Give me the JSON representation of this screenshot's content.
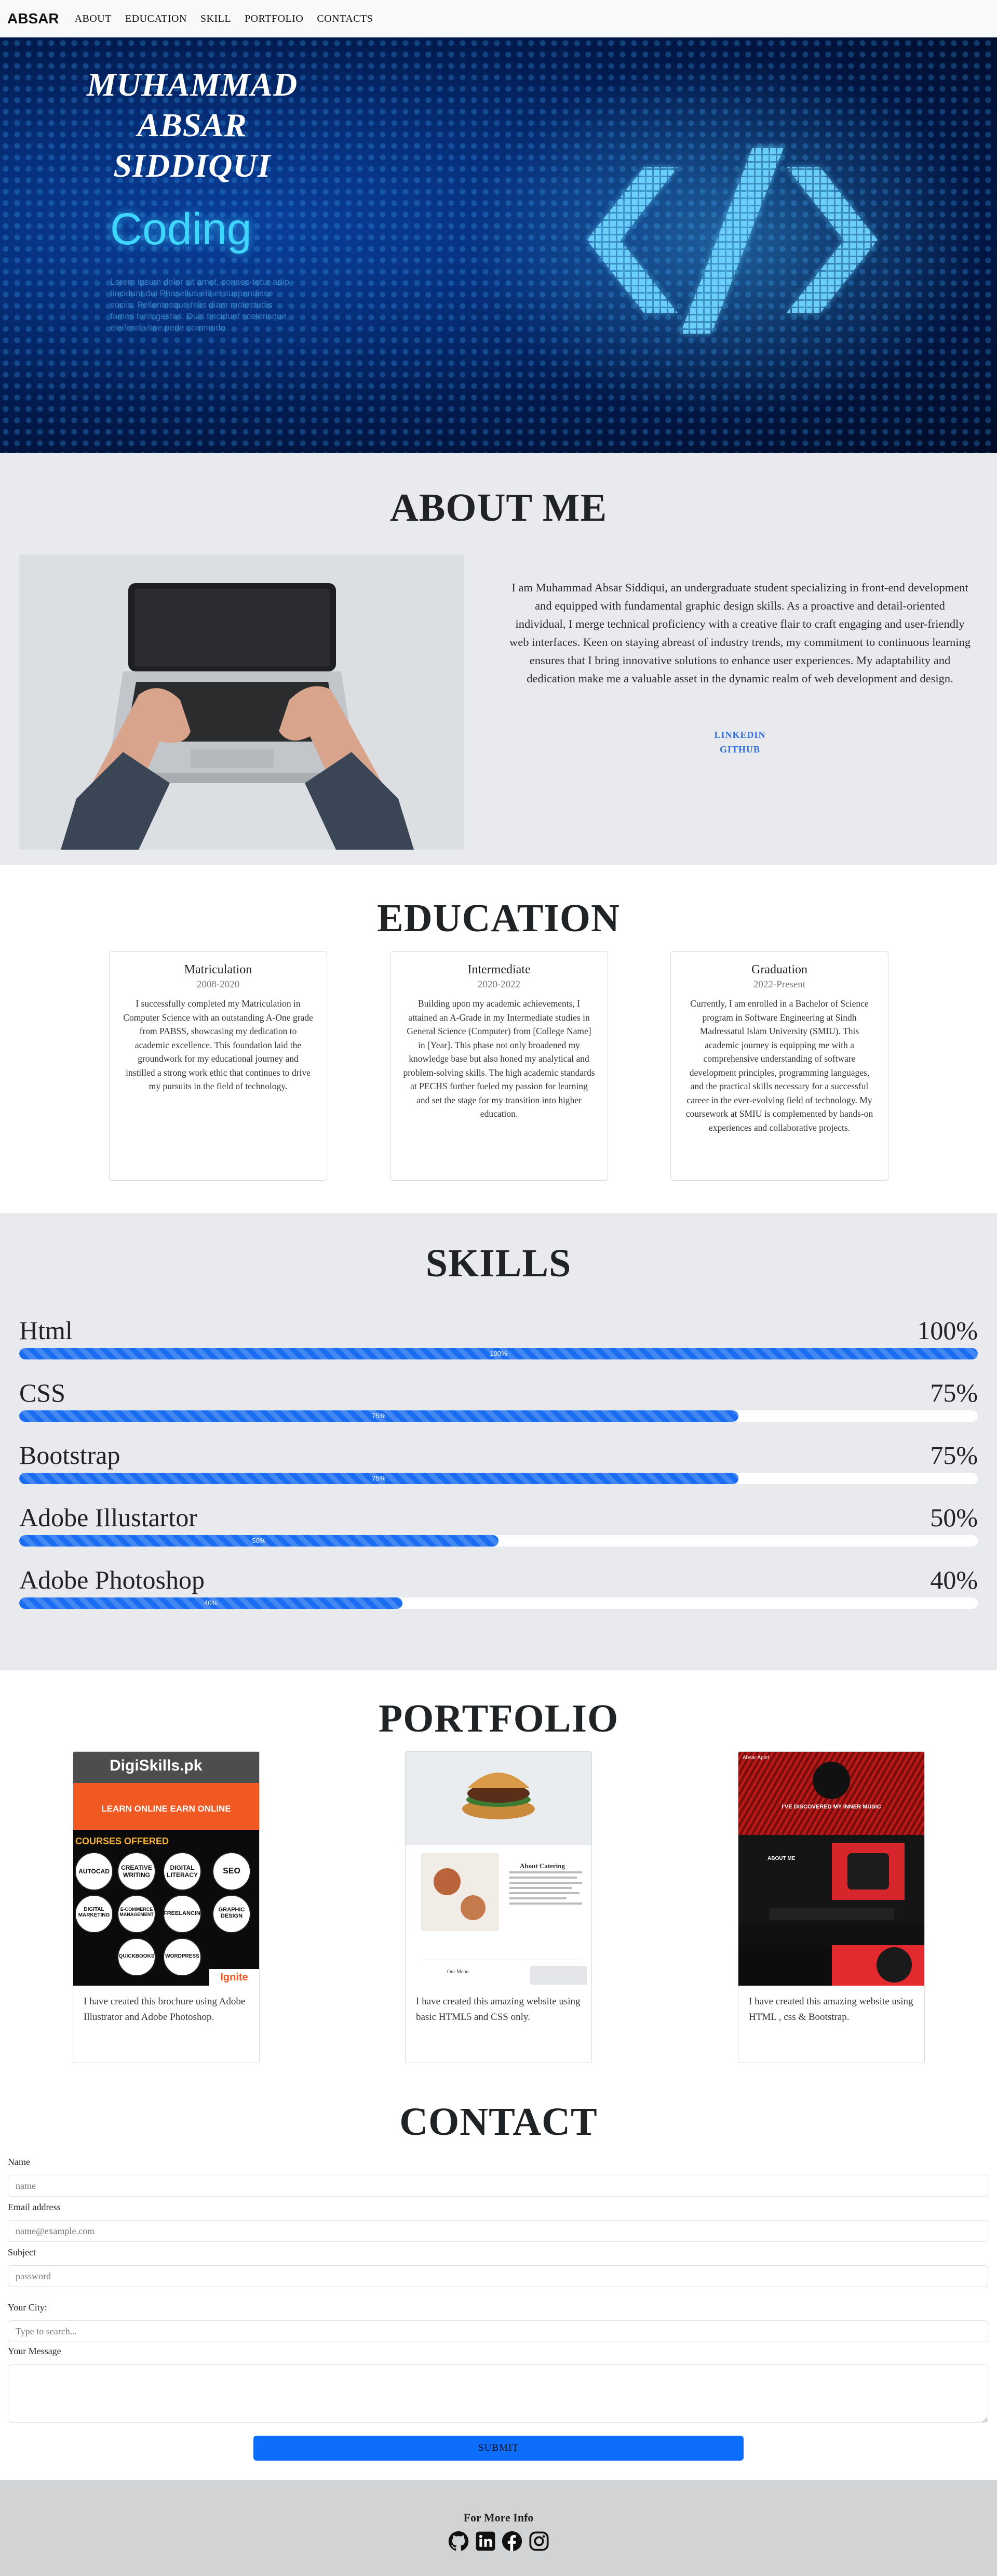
{
  "nav": {
    "brand": "ABSAR",
    "links": [
      "ABOUT",
      "EDUCATION",
      "SKILL",
      "PORTFOLIO",
      "CONTACTS"
    ]
  },
  "hero": {
    "name_line1": "MUHAMMAD",
    "name_line2": "ABSAR",
    "name_line3": "SIDDIQUI",
    "graphic_word": "Coding",
    "graphic_lorem": "Lorem ipsum dolor sit amet, consec-tetur adip tincidunt dui Phasellus elit et suspendisse sociis. Pellentesque felis diam molestudis fames turis gestas. Duis tincidunt scelerisque, eleifend vitae pede commodo."
  },
  "about": {
    "title": "ABOUT ME",
    "text": "I am Muhammad Absar Siddiqui, an undergraduate student specializing in front-end development and equipped with fundamental graphic design skills. As a proactive and detail-oriented individual, I merge technical proficiency with a creative flair to craft engaging and user-friendly web interfaces. Keen on staying abreast of industry trends, my commitment to continuous learning ensures that I bring innovative solutions to enhance user experiences. My adaptability and dedication make me a valuable asset in the dynamic realm of web development and design.",
    "links": [
      "LINKEDIN",
      "GITHUB"
    ]
  },
  "education": {
    "title": "EDUCATION",
    "cards": [
      {
        "title": "Matriculation",
        "date": "2008-2020",
        "body": "I successfully completed my Matriculation in Computer Science with an outstanding A-One grade from PABSS, showcasing my dedication to academic excellence. This foundation laid the groundwork for my educational journey and instilled a strong work ethic that continues to drive my pursuits in the field of technology."
      },
      {
        "title": "Intermediate",
        "date": "2020-2022",
        "body": "Building upon my academic achievements, I attained an A-Grade in my Intermediate studies in General Science (Computer) from [College Name] in [Year]. This phase not only broadened my knowledge base but also honed my analytical and problem-solving skills. The high academic standards at PECHS further fueled my passion for learning and set the stage for my transition into higher education."
      },
      {
        "title": "Graduation",
        "date": "2022-Present",
        "body": "Currently, I am enrolled in a Bachelor of Science program in Software Engineering at Sindh Madressatul Islam University (SMIU). This academic journey is equipping me with a comprehensive understanding of software development principles, programming languages, and the practical skills necessary for a successful career in the ever-evolving field of technology. My coursework at SMIU is complemented by hands-on experiences and collaborative projects."
      }
    ]
  },
  "skills": {
    "title": "SKILLS",
    "items": [
      {
        "name": "Html",
        "label": "100%",
        "value": 100
      },
      {
        "name": "CSS",
        "label": "75%",
        "value": 75
      },
      {
        "name": "Bootstrap",
        "label": "75%",
        "value": 75
      },
      {
        "name": "Adobe Illustartor",
        "label": "50%",
        "value": 50
      },
      {
        "name": "Adobe Photoshop",
        "label": "40%",
        "value": 40
      }
    ]
  },
  "portfolio": {
    "title": "PORTFOLIO",
    "cards": [
      {
        "text": "I have created this brochure using Adobe Illustrator and Adobe Photoshop.",
        "brochure": {
          "logo": "DigiSkills.pk",
          "banner": "LEARN ONLINE EARN ONLINE",
          "courses_title": "COURSES OFFERED",
          "courses": [
            "AUTOCAD",
            "CREATIVE WRITING",
            "DIGITAL LITERACY",
            "SEO",
            "DIGITAL MARKETING",
            "E-COMMERCE MANAGEMENT",
            "FREELANCING",
            "GRAPHIC DESIGN",
            "QUICKBOOKS",
            "WORDPRESS"
          ],
          "brand_corner": "Ignite"
        }
      },
      {
        "text": "I have created this amazing website using basic HTML5 and CSS only.",
        "site": {
          "section1": "About Catering",
          "section2": "Our Menu"
        }
      },
      {
        "text": "I have created this amazing website using HTML , css & Bootstrap.",
        "site": {
          "brand": "Absar Aplet",
          "headline": "I'VE DISCOVERED MY INNER MUSIC",
          "about": "ABOUT ME"
        }
      }
    ]
  },
  "contact": {
    "title": "CONTACT",
    "name_label": "Name",
    "name_placeholder": "name",
    "email_label": "Email address",
    "email_placeholder": "name@example.com",
    "subject_label": "Subject",
    "subject_placeholder": "password",
    "city_label": "Your City:",
    "city_placeholder": "Type to search...",
    "message_label": "Your Message",
    "submit": "SUBMIT"
  },
  "footer": {
    "title": "For More Info",
    "icons": [
      "github-icon",
      "linkedin-icon",
      "facebook-icon",
      "instagram-icon"
    ]
  },
  "colors": {
    "primary": "#0d6efd",
    "section_gray": "#e8eaed",
    "footer_gray": "#d2d3d4",
    "link_blue": "#2f6fe0"
  }
}
